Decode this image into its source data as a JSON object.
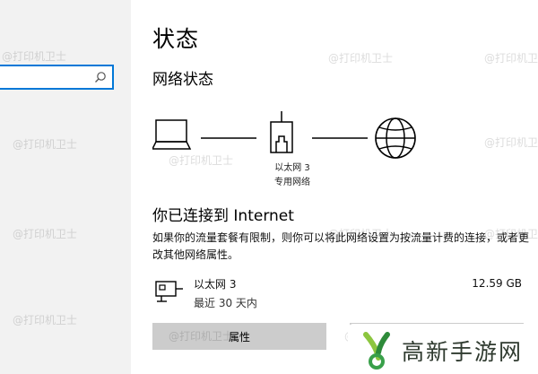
{
  "nav": {
    "search": {
      "value": "",
      "placeholder": ""
    }
  },
  "main": {
    "title": "状态",
    "network_status_title": "网络状态",
    "diagram": {
      "adapter_label": "以太网 3",
      "profile_label": "专用网络"
    },
    "connected_title": "你已连接到 Internet",
    "connected_desc": "如果你的流量套餐有限制，则你可以将此网络设置为按流量计费的连接，或者更改其他网络属性。",
    "adapter": {
      "name": "以太网 3",
      "period": "最近 30 天内",
      "usage": "12.59 GB"
    },
    "buttons": {
      "properties": "属性",
      "data_usage": ""
    }
  },
  "watermark": "@打印机卫士",
  "brand": {
    "text": "高新手游网"
  },
  "icons": {
    "laptop": "laptop-icon",
    "router": "router-icon",
    "globe": "globe-icon",
    "adapter": "ethernet-adapter-icon",
    "search": "search-icon"
  },
  "colors": {
    "accent": "#0078d7",
    "button_bg": "#cccccc",
    "nav_bg": "#f2f2f2"
  }
}
